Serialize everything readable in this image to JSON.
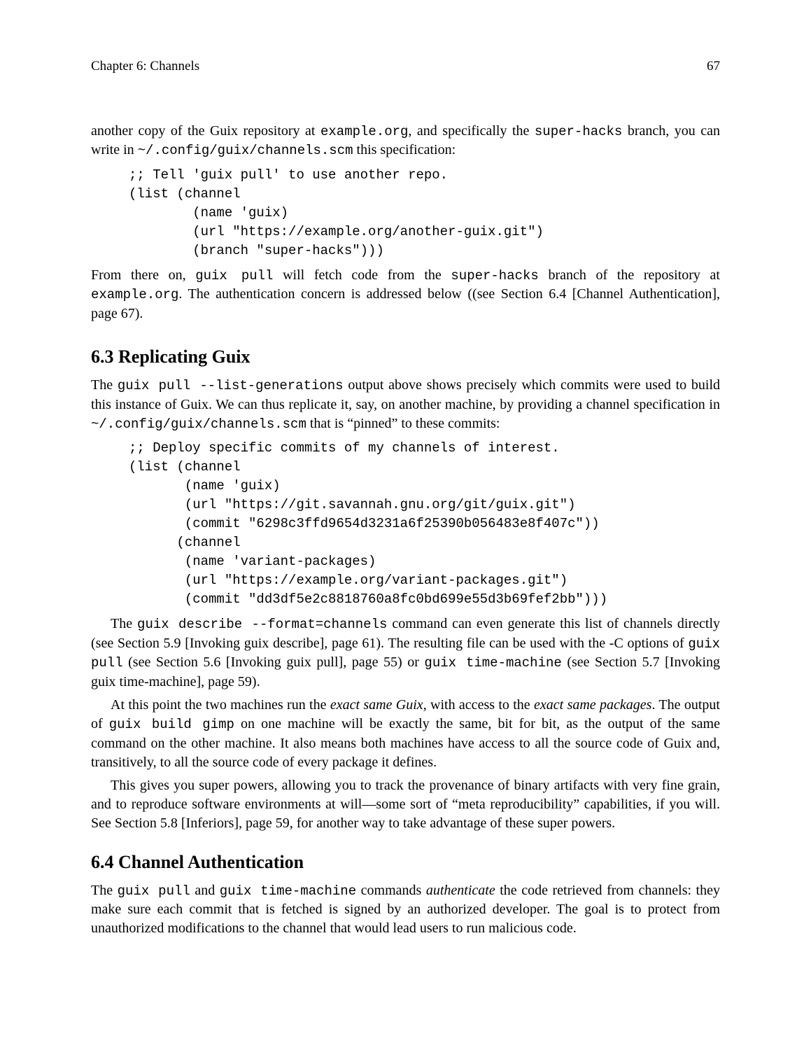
{
  "running_head": {
    "left": "Chapter 6: Channels",
    "right": "67"
  },
  "intro": {
    "p1_a": "another copy of the Guix repository at ",
    "p1_tt1": "example.org",
    "p1_b": ", and specifically the ",
    "p1_tt2": "super-hacks",
    "p1_c": " branch, you can write in ",
    "p1_tt3": "~/.config/guix/channels.scm",
    "p1_d": " this specification:"
  },
  "code1": ";; Tell 'guix pull' to use another repo.\n(list (channel\n        (name 'guix)\n        (url \"https://example.org/another-guix.git\")\n        (branch \"super-hacks\")))",
  "from_there": {
    "a": "From there on, ",
    "tt1": "guix pull",
    "b": " will fetch code from the ",
    "tt2": "super-hacks",
    "c": " branch of the repository at ",
    "tt3": "example.org",
    "d": ". The authentication concern is addressed below ((see Section 6.4 [Channel Authentication], page 67)."
  },
  "s63": {
    "heading": "6.3  Replicating Guix",
    "p1_a": "The ",
    "p1_tt1": "guix pull --list-generations",
    "p1_b": " output above shows precisely which commits were used to build this instance of Guix. We can thus replicate it, say, on another machine, by providing a channel specification in ",
    "p1_tt2": "~/.config/guix/channels.scm",
    "p1_c": " that is “pinned” to these commits:"
  },
  "code2": ";; Deploy specific commits of my channels of interest.\n(list (channel\n       (name 'guix)\n       (url \"https://git.savannah.gnu.org/git/guix.git\")\n       (commit \"6298c3ffd9654d3231a6f25390b056483e8f407c\"))\n      (channel\n       (name 'variant-packages)\n       (url \"https://example.org/variant-packages.git\")\n       (commit \"dd3df5e2c8818760a8fc0bd699e55d3b69fef2bb\")))",
  "s63p2": {
    "a": "The ",
    "tt1": "guix describe --format=channels",
    "b": " command can even generate this list of channels directly (see Section 5.9 [Invoking guix describe], page 61). The resulting file can be used with the -C options of ",
    "tt2": "guix pull",
    "c": " (see Section 5.6 [Invoking guix pull], page 55) or ",
    "tt3": "guix time-machine",
    "d": " (see Section 5.7 [Invoking guix time-machine], page 59)."
  },
  "s63p3": {
    "a": "At this point the two machines run the ",
    "it1": "exact same Guix",
    "b": ", with access to the ",
    "it2": "exact same packages",
    "c": ". The output of ",
    "tt1": "guix build gimp",
    "d": " on one machine will be exactly the same, bit for bit, as the output of the same command on the other machine. It also means both machines have access to all the source code of Guix and, transitively, to all the source code of every package it defines."
  },
  "s63p4": "This gives you super powers, allowing you to track the provenance of binary artifacts with very fine grain, and to reproduce software environments at will—some sort of “meta reproducibility” capabilities, if you will. See Section 5.8 [Inferiors], page 59, for another way to take advantage of these super powers.",
  "s64": {
    "heading": "6.4  Channel Authentication",
    "p1_a": "The ",
    "tt1": "guix pull",
    "p1_b": " and ",
    "tt2": "guix time-machine",
    "p1_c": " commands ",
    "it1": "authenticate",
    "p1_d": " the code retrieved from channels: they make sure each commit that is fetched is signed by an authorized developer. The goal is to protect from unauthorized modifications to the channel that would lead users to run malicious code."
  }
}
